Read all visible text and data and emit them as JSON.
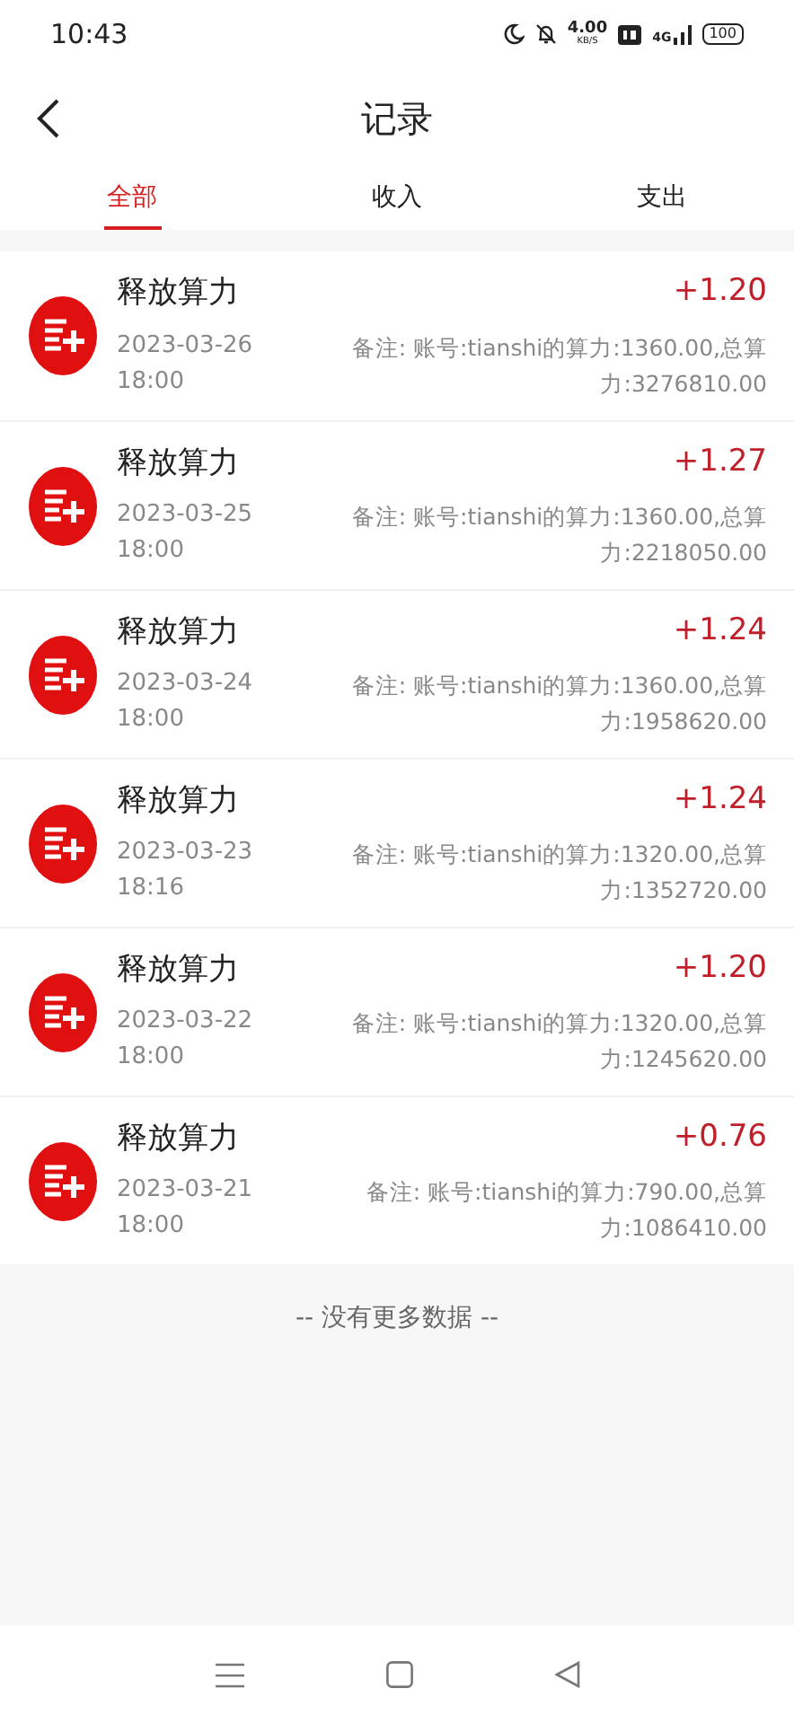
{
  "status_bar": {
    "time": "10:43",
    "speed": "4.00",
    "speed_unit": "KB/S",
    "network": "4G",
    "battery": "100"
  },
  "title": "记录",
  "tabs": [
    {
      "label": "全部",
      "selected": true
    },
    {
      "label": "收入",
      "selected": false
    },
    {
      "label": "支出",
      "selected": false
    }
  ],
  "records": [
    {
      "title": "释放算力",
      "date": "2023-03-26",
      "time": "18:00",
      "amount": "+1.20",
      "note": "备注: 账号:tianshi的算力:1360.00,总算力:3276810.00"
    },
    {
      "title": "释放算力",
      "date": "2023-03-25",
      "time": "18:00",
      "amount": "+1.27",
      "note": "备注: 账号:tianshi的算力:1360.00,总算力:2218050.00"
    },
    {
      "title": "释放算力",
      "date": "2023-03-24",
      "time": "18:00",
      "amount": "+1.24",
      "note": "备注: 账号:tianshi的算力:1360.00,总算力:1958620.00"
    },
    {
      "title": "释放算力",
      "date": "2023-03-23",
      "time": "18:16",
      "amount": "+1.24",
      "note": "备注: 账号:tianshi的算力:1320.00,总算力:1352720.00"
    },
    {
      "title": "释放算力",
      "date": "2023-03-22",
      "time": "18:00",
      "amount": "+1.20",
      "note": "备注: 账号:tianshi的算力:1320.00,总算力:1245620.00"
    },
    {
      "title": "释放算力",
      "date": "2023-03-21",
      "time": "18:00",
      "amount": "+0.76",
      "note": "备注: 账号:tianshi的算力:790.00,总算力:1086410.00"
    }
  ],
  "footer": "-- 没有更多数据 --"
}
